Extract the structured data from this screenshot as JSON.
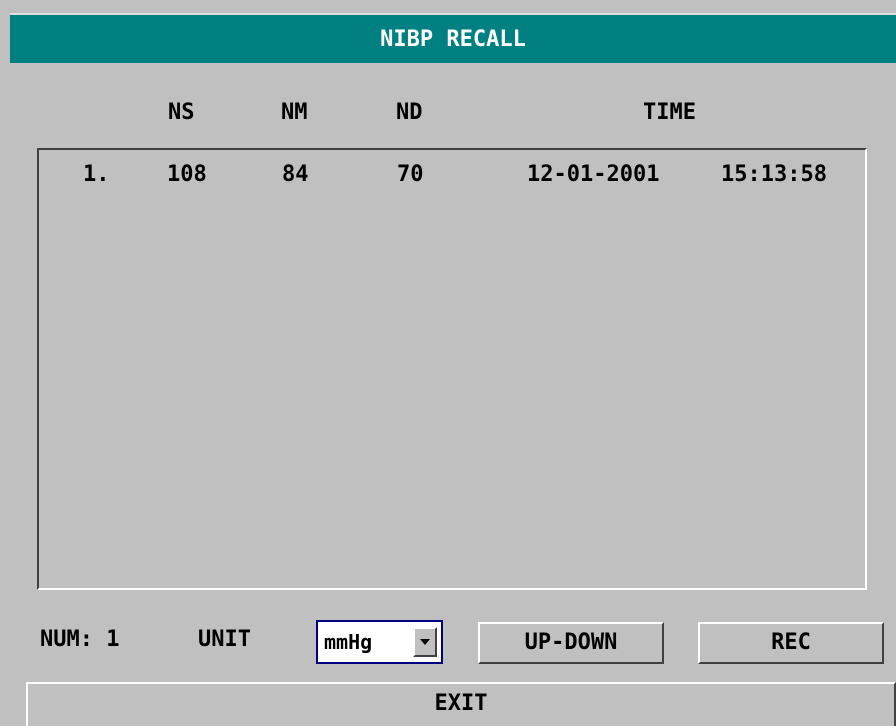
{
  "window": {
    "title": "NIBP RECALL"
  },
  "columns": {
    "ns": "NS",
    "nm": "NM",
    "nd": "ND",
    "time": "TIME"
  },
  "records": [
    {
      "index": "1.",
      "ns": "108",
      "nm": "84",
      "nd": "70",
      "date": "12-01-2001",
      "time": "15:13:58"
    }
  ],
  "footer": {
    "num_label": "NUM: 1",
    "unit_label": "UNIT",
    "unit_value": "mmHg",
    "updown_label": "UP-DOWN",
    "rec_label": "REC",
    "exit_label": "EXIT"
  },
  "colors": {
    "title_bg": "#008080",
    "window_bg": "#c0c0c0",
    "select_border": "#000080"
  },
  "icons": {
    "dropdown": "chevron-down-icon"
  }
}
